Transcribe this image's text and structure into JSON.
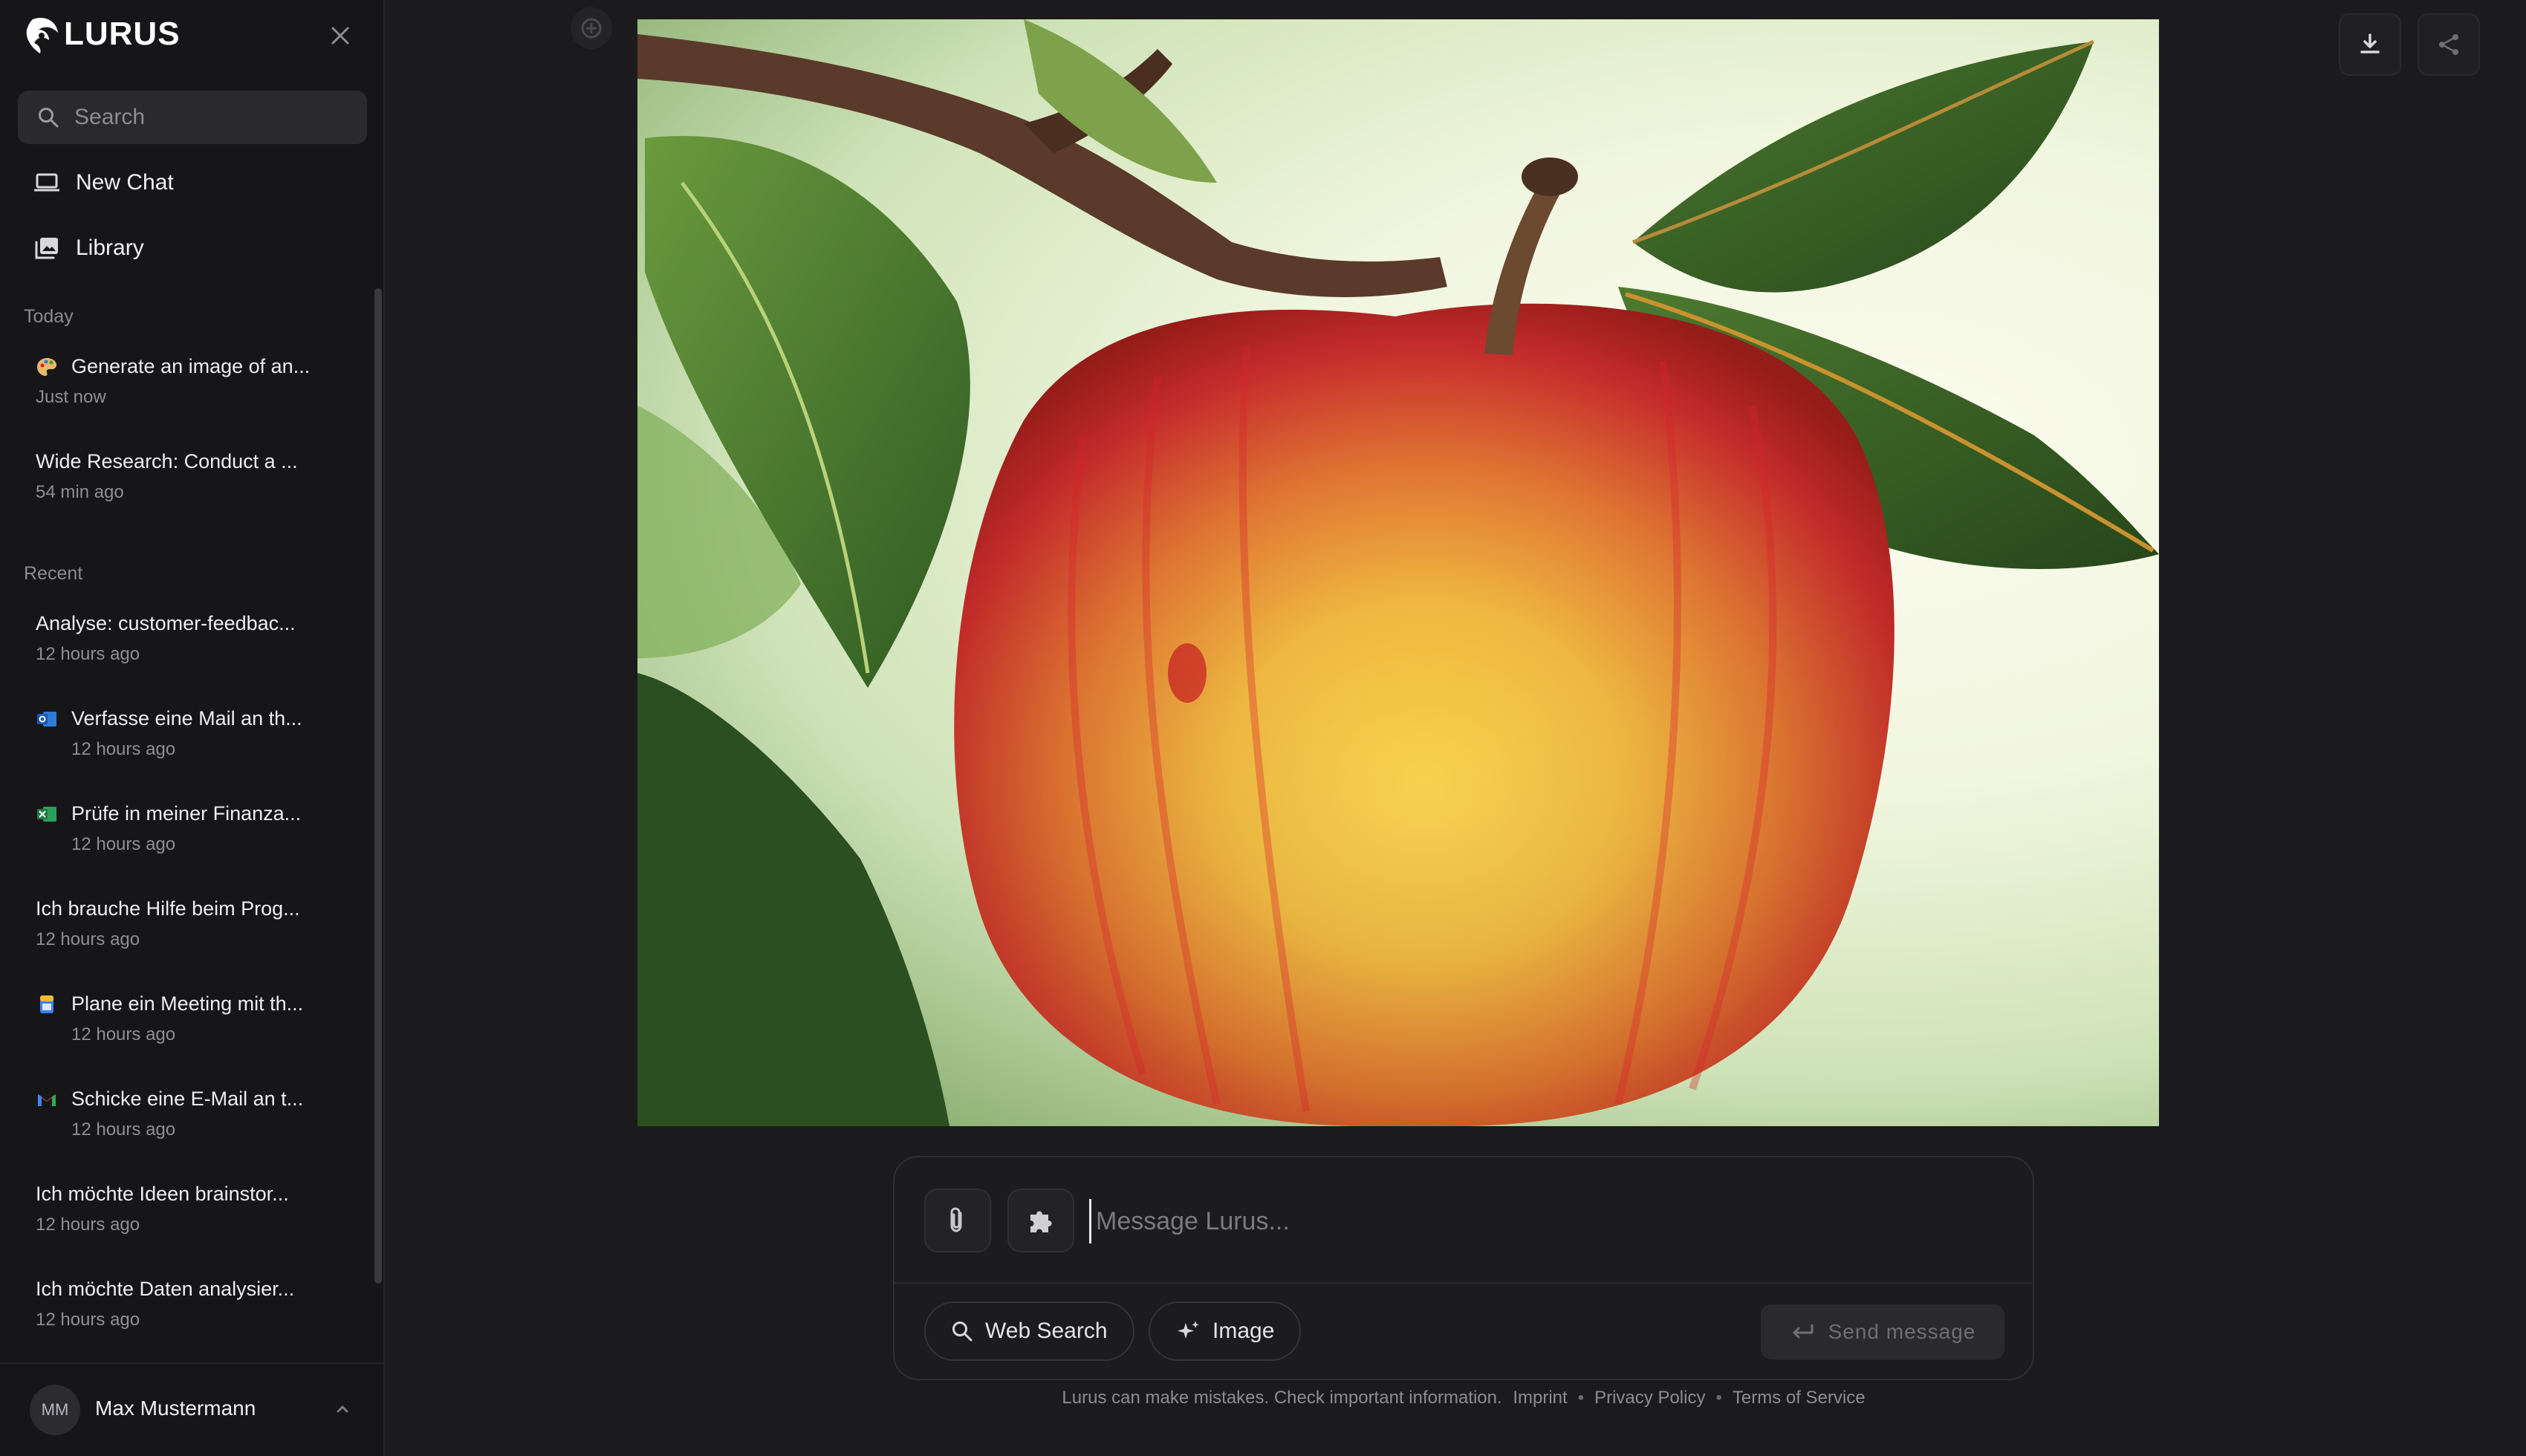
{
  "brand": {
    "name": "LURUS"
  },
  "sidebar": {
    "search_placeholder": "Search",
    "nav": [
      {
        "label": "New Chat",
        "icon": "laptop-icon"
      },
      {
        "label": "Library",
        "icon": "library-icon"
      }
    ],
    "sections": {
      "today": "Today",
      "recent": "Recent"
    },
    "today": [
      {
        "title": "Generate an image of an...",
        "time": "Just now",
        "icon": "palette-icon"
      },
      {
        "title": "Wide Research: Conduct a ...",
        "time": "54 min ago"
      }
    ],
    "recent": [
      {
        "title": "Analyse: customer-feedbac...",
        "time": "12 hours ago"
      },
      {
        "title": "Verfasse eine Mail an th...",
        "time": "12 hours ago",
        "icon": "outlook-icon"
      },
      {
        "title": "Prüfe in meiner Finanza...",
        "time": "12 hours ago",
        "icon": "excel-icon"
      },
      {
        "title": "Ich brauche Hilfe beim Prog...",
        "time": "12 hours ago"
      },
      {
        "title": "Plane ein Meeting mit th...",
        "time": "12 hours ago",
        "icon": "calendar-icon"
      },
      {
        "title": "Schicke eine E-Mail an t...",
        "time": "12 hours ago",
        "icon": "gmail-icon"
      },
      {
        "title": "Ich möchte Ideen brainstor...",
        "time": "12 hours ago"
      },
      {
        "title": "Ich möchte Daten analysier...",
        "time": "12 hours ago"
      }
    ],
    "user": {
      "initials": "MM",
      "name": "Max Mustermann"
    }
  },
  "composer": {
    "placeholder": "Message Lurus...",
    "web_search_label": "Web Search",
    "image_label": "Image",
    "send_label": "Send message"
  },
  "footer": {
    "disclaimer": "Lurus can make mistakes. Check important information.",
    "imprint": "Imprint",
    "privacy": "Privacy Policy",
    "terms": "Terms of Service"
  },
  "colors": {
    "background": "#1b1b1d",
    "sidebar": "#161618",
    "apple_red": "#d8232a",
    "apple_yellow": "#f0b63a",
    "leaf_green": "#3f6b2c"
  }
}
